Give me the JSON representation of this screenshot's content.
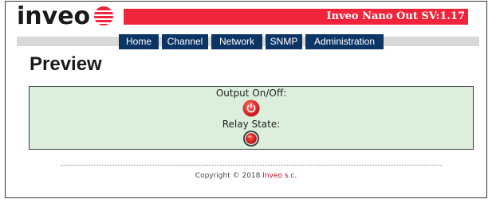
{
  "brand": {
    "logo_text": "inveo",
    "logo_icon": "striped-globe-logo-icon",
    "title": "Inveo Nano Out SV:1.17",
    "accent_color": "#f0243a",
    "nav_color": "#0c3566"
  },
  "nav": {
    "items": [
      {
        "label": "Home"
      },
      {
        "label": "Channel"
      },
      {
        "label": "Network"
      },
      {
        "label": "SNMP"
      },
      {
        "label": "Administration"
      }
    ]
  },
  "page": {
    "title": "Preview"
  },
  "preview": {
    "output_label": "Output On/Off:",
    "output_icon": "power-button-icon",
    "relay_label": "Relay State:",
    "relay_icon": "relay-state-led-icon",
    "relay_state_color": "#e02020"
  },
  "footer": {
    "copyright_prefix": "Copyright © 2018",
    "company": "Inveo s.c."
  }
}
